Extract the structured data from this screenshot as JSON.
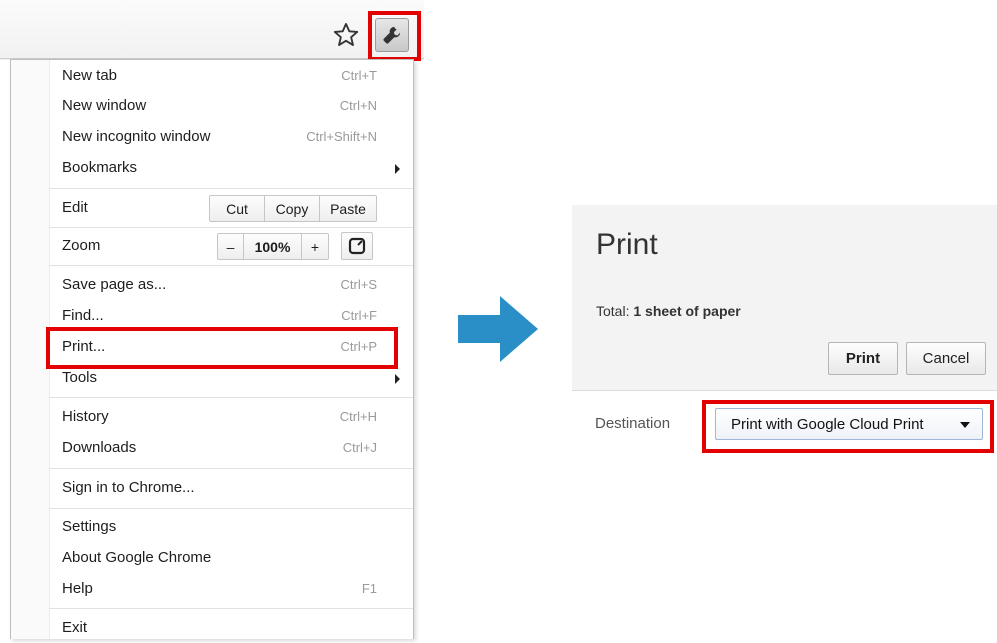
{
  "menu": {
    "items": [
      {
        "label": "New tab",
        "shortcut": "Ctrl+T"
      },
      {
        "label": "New window",
        "shortcut": "Ctrl+N"
      },
      {
        "label": "New incognito window",
        "shortcut": "Ctrl+Shift+N"
      },
      {
        "label": "Bookmarks",
        "shortcut": ""
      },
      {
        "label": "Edit",
        "shortcut": ""
      },
      {
        "label": "Zoom",
        "shortcut": ""
      },
      {
        "label": "Save page as...",
        "shortcut": "Ctrl+S"
      },
      {
        "label": "Find...",
        "shortcut": "Ctrl+F"
      },
      {
        "label": "Print...",
        "shortcut": "Ctrl+P"
      },
      {
        "label": "Tools",
        "shortcut": ""
      },
      {
        "label": "History",
        "shortcut": "Ctrl+H"
      },
      {
        "label": "Downloads",
        "shortcut": "Ctrl+J"
      },
      {
        "label": "Sign in to Chrome...",
        "shortcut": ""
      },
      {
        "label": "Settings",
        "shortcut": ""
      },
      {
        "label": "About Google Chrome",
        "shortcut": ""
      },
      {
        "label": "Help",
        "shortcut": "F1"
      },
      {
        "label": "Exit",
        "shortcut": ""
      }
    ],
    "edit": {
      "cut": "Cut",
      "copy": "Copy",
      "paste": "Paste"
    },
    "zoom": {
      "minus": "–",
      "value": "100%",
      "plus": "+"
    }
  },
  "icons": {
    "star": "star-icon",
    "wrench": "wrench-icon",
    "fullscreen": "fullscreen-icon",
    "arrow": "arrow-right-icon"
  },
  "print": {
    "title": "Print",
    "total_label": "Total:",
    "total_value": "1 sheet of paper",
    "print_button": "Print",
    "cancel_button": "Cancel",
    "destination_label": "Destination",
    "destination_value": "Print with Google Cloud Print"
  },
  "colors": {
    "highlight": "#e30000",
    "arrow": "#2a8fc6"
  }
}
